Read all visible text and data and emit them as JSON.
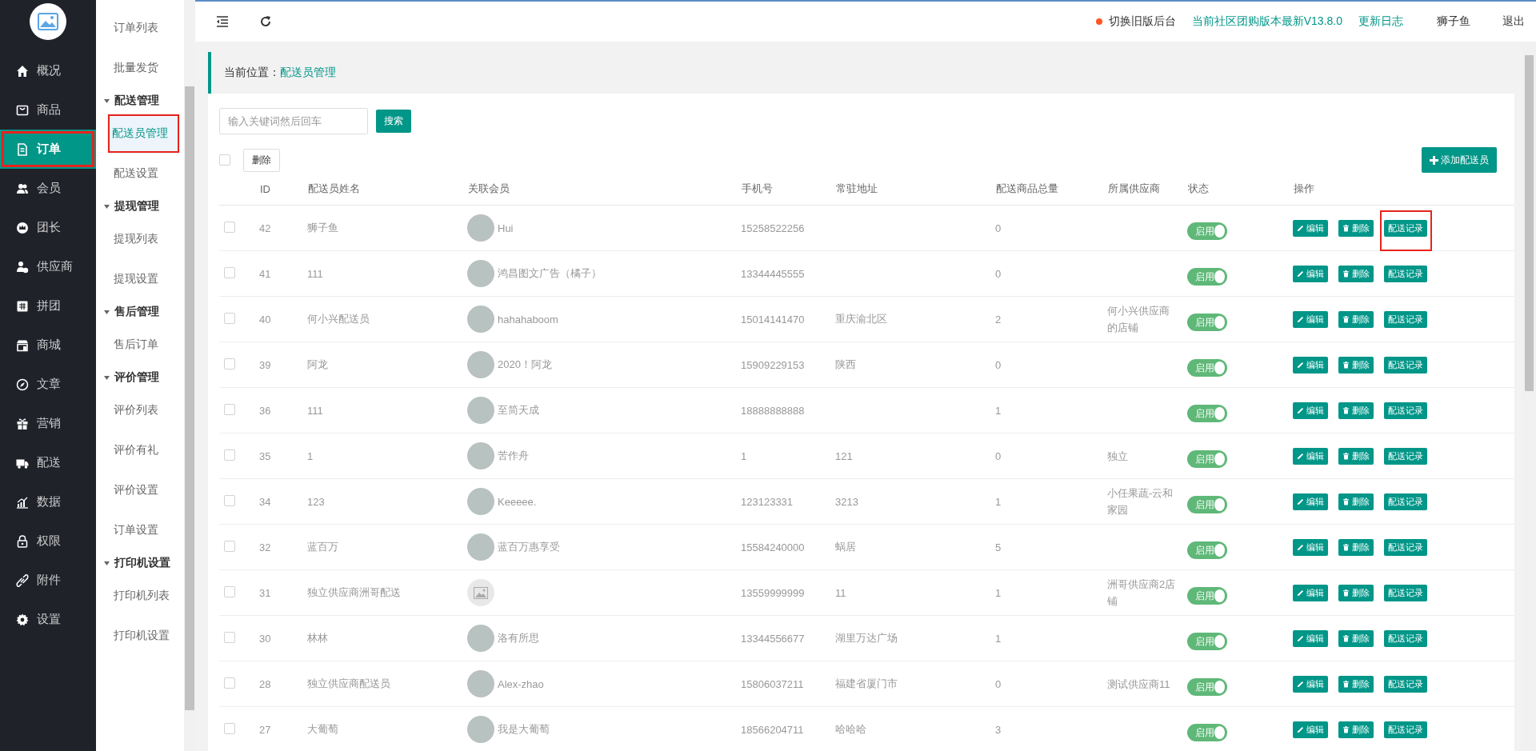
{
  "nav": [
    {
      "label": "概况",
      "selected": false,
      "highlighted": false
    },
    {
      "label": "商品",
      "selected": false,
      "highlighted": false
    },
    {
      "label": "订单",
      "selected": true,
      "highlighted": true
    },
    {
      "label": "会员",
      "selected": false,
      "highlighted": false
    },
    {
      "label": "团长",
      "selected": false,
      "highlighted": false
    },
    {
      "label": "供应商",
      "selected": false,
      "highlighted": false
    },
    {
      "label": "拼团",
      "selected": false,
      "highlighted": false
    },
    {
      "label": "商城",
      "selected": false,
      "highlighted": false
    },
    {
      "label": "文章",
      "selected": false,
      "highlighted": false
    },
    {
      "label": "营销",
      "selected": false,
      "highlighted": false
    },
    {
      "label": "配送",
      "selected": false,
      "highlighted": false
    },
    {
      "label": "数据",
      "selected": false,
      "highlighted": false
    },
    {
      "label": "权限",
      "selected": false,
      "highlighted": false
    },
    {
      "label": "附件",
      "selected": false,
      "highlighted": false
    },
    {
      "label": "设置",
      "selected": false,
      "highlighted": false
    }
  ],
  "subnav": [
    {
      "kind": "link",
      "label": "订单列表",
      "selected": false,
      "highlighted": false
    },
    {
      "kind": "link",
      "label": "批量发货",
      "selected": false,
      "highlighted": false
    },
    {
      "kind": "group",
      "label": "配送管理"
    },
    {
      "kind": "link",
      "label": "配送员管理",
      "selected": true,
      "highlighted": true
    },
    {
      "kind": "link",
      "label": "配送设置",
      "selected": false,
      "highlighted": false
    },
    {
      "kind": "group",
      "label": "提现管理"
    },
    {
      "kind": "link",
      "label": "提现列表",
      "selected": false,
      "highlighted": false
    },
    {
      "kind": "link",
      "label": "提现设置",
      "selected": false,
      "highlighted": false
    },
    {
      "kind": "group",
      "label": "售后管理"
    },
    {
      "kind": "link",
      "label": "售后订单",
      "selected": false,
      "highlighted": false
    },
    {
      "kind": "group",
      "label": "评价管理"
    },
    {
      "kind": "link",
      "label": "评价列表",
      "selected": false,
      "highlighted": false
    },
    {
      "kind": "link",
      "label": "评价有礼",
      "selected": false,
      "highlighted": false
    },
    {
      "kind": "link",
      "label": "评价设置",
      "selected": false,
      "highlighted": false
    },
    {
      "kind": "link",
      "label": "订单设置",
      "selected": false,
      "highlighted": false
    },
    {
      "kind": "group",
      "label": "打印机设置"
    },
    {
      "kind": "link",
      "label": "打印机列表",
      "selected": false,
      "highlighted": false
    },
    {
      "kind": "link",
      "label": "打印机设置",
      "selected": false,
      "highlighted": false
    }
  ],
  "topbar": {
    "switch_old": "切换旧版后台",
    "version": "当前社区团购版本最新V13.8.0",
    "changelog": "更新日志",
    "user": "狮子鱼",
    "logout": "退出"
  },
  "breadcrumb": {
    "label": "当前位置：",
    "current": "配送员管理"
  },
  "search": {
    "placeholder": "输入关键词然后回车",
    "button": "搜索"
  },
  "select_all_checked": false,
  "bulk_delete": "删除",
  "add_button": "添加配送员",
  "table": {
    "columns": [
      "ID",
      "配送员姓名",
      "关联会员",
      "手机号",
      "常驻地址",
      "配送商品总量",
      "所属供应商",
      "状态",
      "操作"
    ],
    "rows": [
      {
        "id": "42",
        "checked": false,
        "name": "狮子鱼",
        "has_photo": true,
        "member": "Hui",
        "phone": "15258522256",
        "address": "",
        "total": "0",
        "supplier": "",
        "status": "启用",
        "on": true,
        "edit": "编辑",
        "delete": "删除",
        "records": "配送记录",
        "highlighted": true
      },
      {
        "id": "41",
        "checked": false,
        "name": "111",
        "has_photo": true,
        "member": "鸿昌图文广告（橘子）",
        "phone": "13344445555",
        "address": "",
        "total": "0",
        "supplier": "",
        "status": "启用",
        "on": true,
        "edit": "编辑",
        "delete": "删除",
        "records": "配送记录",
        "highlighted": false
      },
      {
        "id": "40",
        "checked": false,
        "name": "何小兴配送员",
        "has_photo": true,
        "member": "hahahaboom",
        "phone": "15014141470",
        "address": "重庆渝北区",
        "total": "2",
        "supplier": "何小兴供应商的店铺",
        "status": "启用",
        "on": true,
        "edit": "编辑",
        "delete": "删除",
        "records": "配送记录",
        "highlighted": false
      },
      {
        "id": "39",
        "checked": false,
        "name": "阿龙",
        "has_photo": true,
        "member": "2020！阿龙",
        "phone": "15909229153",
        "address": "陕西",
        "total": "0",
        "supplier": "",
        "status": "启用",
        "on": true,
        "edit": "编辑",
        "delete": "删除",
        "records": "配送记录",
        "highlighted": false
      },
      {
        "id": "36",
        "checked": false,
        "name": "111",
        "has_photo": true,
        "member": "至简天成",
        "phone": "18888888888",
        "address": "",
        "total": "1",
        "supplier": "",
        "status": "启用",
        "on": true,
        "edit": "编辑",
        "delete": "删除",
        "records": "配送记录",
        "highlighted": false
      },
      {
        "id": "35",
        "checked": false,
        "name": "1",
        "has_photo": true,
        "member": "苦作舟",
        "phone": "1",
        "address": "121",
        "total": "0",
        "supplier": "独立",
        "status": "启用",
        "on": true,
        "edit": "编辑",
        "delete": "删除",
        "records": "配送记录",
        "highlighted": false
      },
      {
        "id": "34",
        "checked": false,
        "name": "123",
        "has_photo": true,
        "member": "Keeeee.",
        "phone": "123123331",
        "address": "3213",
        "total": "1",
        "supplier": "小任果蔬-云和家园",
        "status": "启用",
        "on": true,
        "edit": "编辑",
        "delete": "删除",
        "records": "配送记录",
        "highlighted": false
      },
      {
        "id": "32",
        "checked": false,
        "name": "蓝百万",
        "has_photo": true,
        "member": "蓝百万惠享受",
        "phone": "15584240000",
        "address": "蜗居",
        "total": "5",
        "supplier": "",
        "status": "启用",
        "on": true,
        "edit": "编辑",
        "delete": "删除",
        "records": "配送记录",
        "highlighted": false
      },
      {
        "id": "31",
        "checked": false,
        "name": "独立供应商洲哥配送",
        "has_photo": false,
        "member": "",
        "phone": "13559999999",
        "address": "11",
        "total": "1",
        "supplier": "洲哥供应商2店铺",
        "status": "启用",
        "on": true,
        "edit": "编辑",
        "delete": "删除",
        "records": "配送记录",
        "highlighted": false
      },
      {
        "id": "30",
        "checked": false,
        "name": "林林",
        "has_photo": true,
        "member": "洛有所思",
        "phone": "13344556677",
        "address": "湖里万达广场",
        "total": "1",
        "supplier": "",
        "status": "启用",
        "on": true,
        "edit": "编辑",
        "delete": "删除",
        "records": "配送记录",
        "highlighted": false
      },
      {
        "id": "28",
        "checked": false,
        "name": "独立供应商配送员",
        "has_photo": true,
        "member": "Alex-zhao",
        "phone": "15806037211",
        "address": "福建省厦门市",
        "total": "0",
        "supplier": "测试供应商11",
        "status": "启用",
        "on": true,
        "edit": "编辑",
        "delete": "删除",
        "records": "配送记录",
        "highlighted": false
      },
      {
        "id": "27",
        "checked": false,
        "name": "大葡萄",
        "has_photo": true,
        "member": "我是大葡萄",
        "phone": "18566204711",
        "address": "哈哈哈",
        "total": "3",
        "supplier": "",
        "status": "启用",
        "on": true,
        "edit": "编辑",
        "delete": "删除",
        "records": "配送记录",
        "highlighted": false
      }
    ]
  }
}
